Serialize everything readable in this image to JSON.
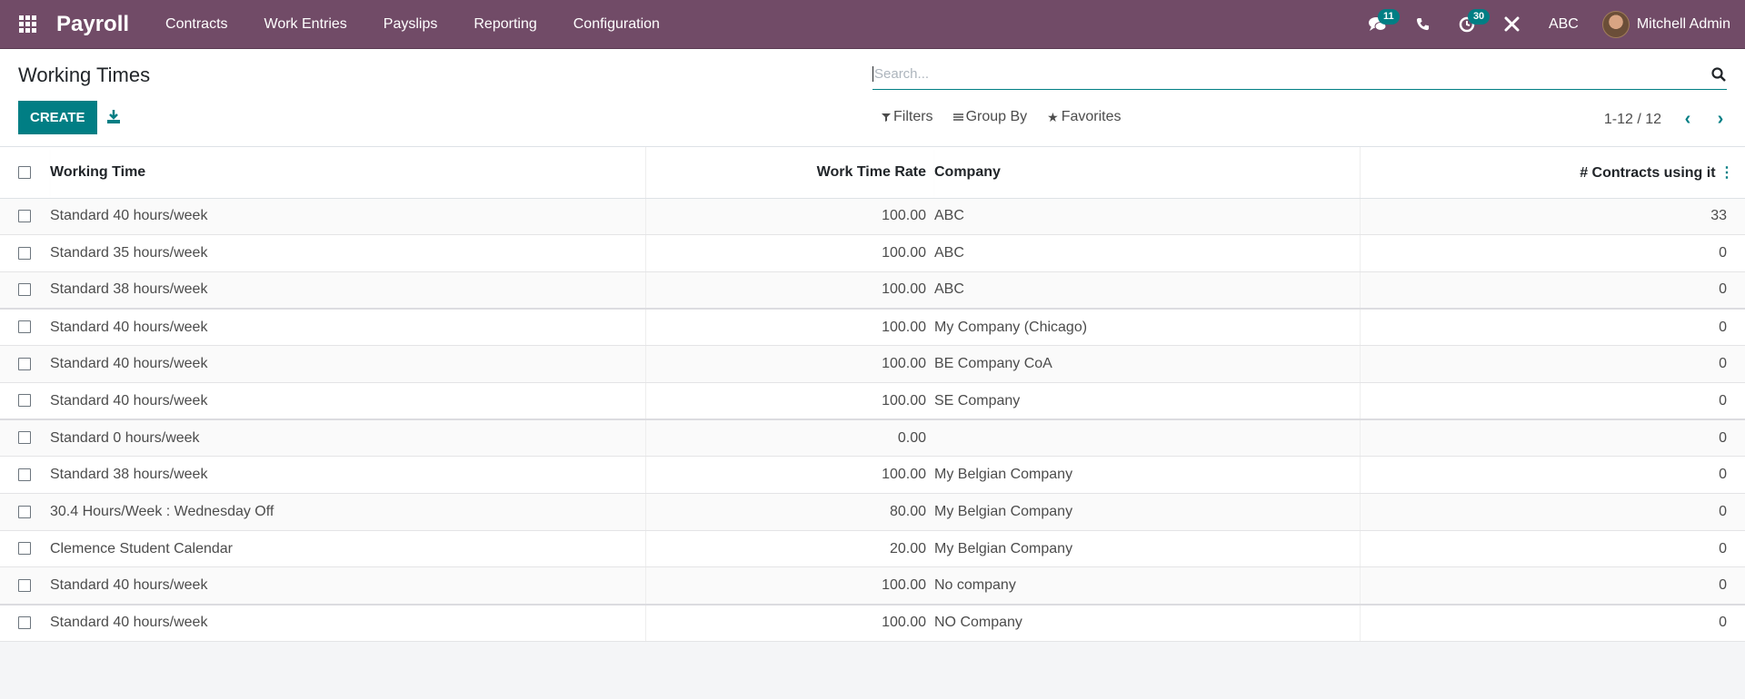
{
  "navbar": {
    "brand": "Payroll",
    "menu": [
      "Contracts",
      "Work Entries",
      "Payslips",
      "Reporting",
      "Configuration"
    ],
    "messages_count": "11",
    "activities_count": "30",
    "company": "ABC",
    "user": "Mitchell Admin",
    "accent_color": "#714b67"
  },
  "control_panel": {
    "title": "Working Times",
    "create_label": "CREATE",
    "search_placeholder": "Search...",
    "filters_label": "Filters",
    "group_by_label": "Group By",
    "favorites_label": "Favorites",
    "pager": "1-12 / 12"
  },
  "table": {
    "headers": {
      "name": "Working Time",
      "rate": "Work Time Rate",
      "company": "Company",
      "contracts": "# Contracts using it"
    },
    "rows": [
      {
        "name": "Standard 40 hours/week",
        "rate": "100.00",
        "company": "ABC",
        "contracts": "33"
      },
      {
        "name": "Standard 35 hours/week",
        "rate": "100.00",
        "company": "ABC",
        "contracts": "0"
      },
      {
        "name": "Standard 38 hours/week",
        "rate": "100.00",
        "company": "ABC",
        "contracts": "0"
      },
      {
        "name": "Standard 40 hours/week",
        "rate": "100.00",
        "company": "My Company (Chicago)",
        "contracts": "0"
      },
      {
        "name": "Standard 40 hours/week",
        "rate": "100.00",
        "company": "BE Company CoA",
        "contracts": "0"
      },
      {
        "name": "Standard 40 hours/week",
        "rate": "100.00",
        "company": "SE Company",
        "contracts": "0"
      },
      {
        "name": "Standard 0 hours/week",
        "rate": "0.00",
        "company": "",
        "contracts": "0"
      },
      {
        "name": "Standard 38 hours/week",
        "rate": "100.00",
        "company": "My Belgian Company",
        "contracts": "0"
      },
      {
        "name": "30.4 Hours/Week : Wednesday Off",
        "rate": "80.00",
        "company": "My Belgian Company",
        "contracts": "0"
      },
      {
        "name": "Clemence Student Calendar",
        "rate": "20.00",
        "company": "My Belgian Company",
        "contracts": "0"
      },
      {
        "name": "Standard 40 hours/week",
        "rate": "100.00",
        "company": "No company",
        "contracts": "0"
      },
      {
        "name": "Standard 40 hours/week",
        "rate": "100.00",
        "company": "NO Company",
        "contracts": "0"
      }
    ]
  }
}
